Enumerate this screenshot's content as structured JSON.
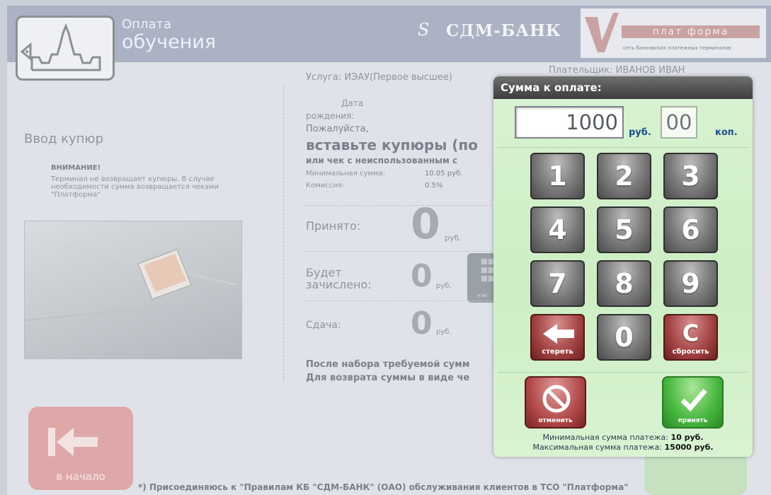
{
  "header": {
    "title_line1": "Оплата",
    "title_line2": "обучения",
    "bank_name": "СДМ-БАНК",
    "bank_mark": "S",
    "platform_word": "плат форма",
    "platform_sub": "сеть банковских платежных терминалов"
  },
  "left_panel": {
    "section_title": "Ввод купюр",
    "warning_title": "ВНИМАНИЕ!",
    "warning_text": "Терминал не возвращает купюры. В случае необходимости сумма возвращается чеками \"Платформа\""
  },
  "center_panel": {
    "service_label": "Услуга:",
    "service_value": "ИЭАУ(Первое высшее)",
    "birth_label_1": "Дата",
    "birth_label_2": "рождения:",
    "please": "Пожалуйста,",
    "insert_bills": "вставьте купюры (по",
    "or_check": "или чек с неиспользованным с",
    "min_sum_label": "Минимальная сумма:",
    "min_sum_value": "10.05 руб.",
    "commission_label": "Комиссия:",
    "commission_value": "0.5%",
    "accepted_label": "Принято:",
    "accepted_value": "0",
    "will_credit_label_1": "Будет",
    "will_credit_label_2": "зачислено:",
    "will_credit_value": "0",
    "change_label": "Сдача:",
    "change_value": "0",
    "rub": "руб.",
    "after_text_1": "После набора требуемой сумм",
    "after_text_2": "Для возврата суммы в виде че",
    "calc_label": "изм"
  },
  "payer": {
    "label": "Плательщик:",
    "value": "ИВАНОВ ИВАН"
  },
  "home_button": {
    "label": "в начало"
  },
  "footer": {
    "note": "*) Присоединяюсь к \"Правилам КБ \"СДМ-БАНК\" (ОАО) обслуживания клиентов в ТСО \"Платформа\""
  },
  "modal": {
    "title": "Сумма к оплате:",
    "amount": "1000",
    "rub_label": "руб.",
    "kop": "00",
    "kop_label": "коп.",
    "keys": [
      "1",
      "2",
      "3",
      "4",
      "5",
      "6",
      "7",
      "8",
      "9"
    ],
    "erase_label": "стереть",
    "zero": "0",
    "clear_glyph": "C",
    "clear_label": "сбросить",
    "cancel_label": "отменить",
    "accept_label": "принять",
    "min_label": "Минимальная сумма платежа:",
    "min_value": "10 руб.",
    "max_label": "Максимальная сумма платежа:",
    "max_value": "15000 руб."
  },
  "colors": {
    "header_band": "#aab2c4",
    "modal_bg": "#cdeec4",
    "key_gray": "#7a7a7a",
    "key_red": "#a24242",
    "accept_green": "#47b73d",
    "rub_blue": "#1b4f8c"
  }
}
